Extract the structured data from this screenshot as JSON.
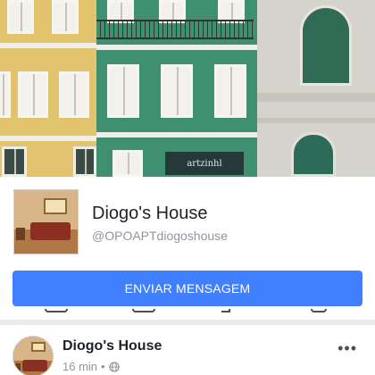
{
  "cover": {
    "shop_sign": "artzinhl"
  },
  "profile": {
    "name": "Diogo's House",
    "handle": "@OPOAPTdiogoshouse",
    "message_button": "ENVIAR MENSAGEM"
  },
  "action_icons": [
    "phone-icon",
    "camera-icon",
    "share-icon",
    "bookmark-icon"
  ],
  "post": {
    "author": "Diogo's House",
    "time": "16 min",
    "separator": "•",
    "privacy_icon": "globe-icon",
    "more_icon": "more-options-icon"
  },
  "colors": {
    "accent": "#4080ff",
    "text_primary": "#1d2129",
    "text_secondary": "#90949c",
    "background": "#e9ebee"
  }
}
